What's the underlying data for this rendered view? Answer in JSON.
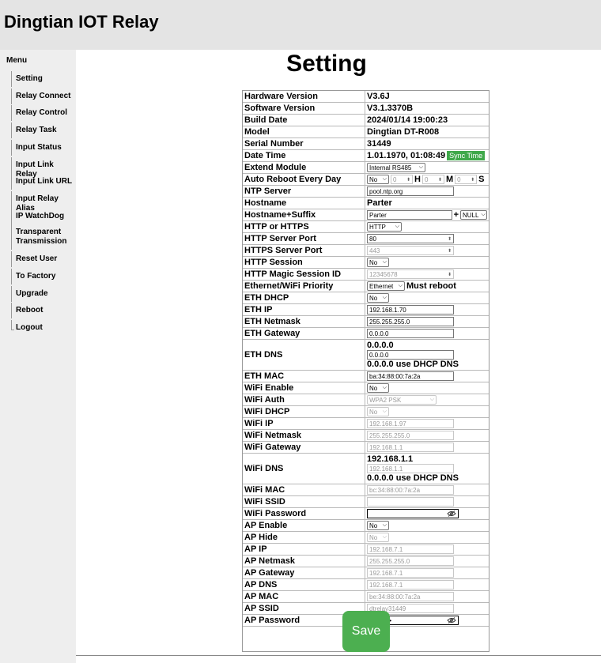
{
  "app_title": "Dingtian IOT Relay",
  "menu": {
    "title": "Menu",
    "items": [
      {
        "label": "Setting"
      },
      {
        "label": "Relay Connect"
      },
      {
        "label": "Relay Control"
      },
      {
        "label": "Relay Task"
      },
      {
        "label": "Input Status"
      },
      {
        "label": "Input Link Relay"
      },
      {
        "label": "Input Link URL"
      },
      {
        "label": "Input Relay Alias"
      },
      {
        "label": "IP WatchDog"
      },
      {
        "label": "Transparent Transmission"
      },
      {
        "label": "Reset User"
      },
      {
        "label": "To Factory"
      },
      {
        "label": "Upgrade"
      },
      {
        "label": "Reboot"
      },
      {
        "label": "Logout"
      }
    ]
  },
  "page_title": "Setting",
  "rows": {
    "hardware_version": {
      "label": "Hardware Version",
      "value": "V3.6J"
    },
    "software_version": {
      "label": "Software Version",
      "value": "V3.1.3370B"
    },
    "build_date": {
      "label": "Build Date",
      "value": "2024/01/14 19:00:23"
    },
    "model": {
      "label": "Model",
      "value": "Dingtian DT-R008"
    },
    "serial_number": {
      "label": "Serial Number",
      "value": "31449"
    },
    "date_time": {
      "label": "Date Time",
      "value": "1.01.1970, 01:08:49",
      "button": "Sync Time"
    },
    "extend_module": {
      "label": "Extend Module",
      "selected": "Internal RS485"
    },
    "auto_reboot": {
      "label": "Auto Reboot Every Day",
      "enable": "No",
      "hour": "0",
      "h_label": "H",
      "minute": "0",
      "m_label": "M",
      "second": "0",
      "s_label": "S"
    },
    "ntp_server": {
      "label": "NTP Server",
      "value": "pool.ntp.org"
    },
    "hostname": {
      "label": "Hostname",
      "value": "Parter"
    },
    "hostname_suffix": {
      "label": "Hostname+Suffix",
      "value": "Parter",
      "plus": "+",
      "suffix": "NULL"
    },
    "http_or_https": {
      "label": "HTTP or HTTPS",
      "selected": "HTTP"
    },
    "http_port": {
      "label": "HTTP Server Port",
      "value": "80"
    },
    "https_port": {
      "label": "HTTPS Server Port",
      "value": "443"
    },
    "http_session": {
      "label": "HTTP Session",
      "selected": "No"
    },
    "http_magic": {
      "label": "HTTP Magic Session ID",
      "value": "12345678"
    },
    "priority": {
      "label": "Ethernet/WiFi Priority",
      "selected": "Ethernet",
      "note": "Must reboot"
    },
    "eth_dhcp": {
      "label": "ETH DHCP",
      "selected": "No"
    },
    "eth_ip": {
      "label": "ETH IP",
      "value": "192.168.1.70"
    },
    "eth_netmask": {
      "label": "ETH Netmask",
      "value": "255.255.255.0"
    },
    "eth_gateway": {
      "label": "ETH Gateway",
      "value": "0.0.0.0"
    },
    "eth_dns": {
      "label": "ETH DNS",
      "top": "0.0.0.0",
      "value": "0.0.0.0",
      "note": "0.0.0.0 use DHCP DNS"
    },
    "eth_mac": {
      "label": "ETH MAC",
      "value": "ba:34:88:00:7a:2a"
    },
    "wifi_enable": {
      "label": "WiFi Enable",
      "selected": "No"
    },
    "wifi_auth": {
      "label": "WiFi Auth",
      "selected": "WPA2 PSK"
    },
    "wifi_dhcp": {
      "label": "WiFi DHCP",
      "selected": "No"
    },
    "wifi_ip": {
      "label": "WiFi IP",
      "value": "192.168.1.97"
    },
    "wifi_netmask": {
      "label": "WiFi Netmask",
      "value": "255.255.255.0"
    },
    "wifi_gateway": {
      "label": "WiFi Gateway",
      "value": "192.168.1.1"
    },
    "wifi_dns": {
      "label": "WiFi DNS",
      "top": "192.168.1.1",
      "value": "192.168.1.1",
      "note": "0.0.0.0 use DHCP DNS"
    },
    "wifi_mac": {
      "label": "WiFi MAC",
      "value": "bc:34:88:00:7a:2a"
    },
    "wifi_ssid": {
      "label": "WiFi SSID",
      "value": ""
    },
    "wifi_password": {
      "label": "WiFi Password",
      "value": ""
    },
    "ap_enable": {
      "label": "AP Enable",
      "selected": "No"
    },
    "ap_hide": {
      "label": "AP Hide",
      "selected": "No"
    },
    "ap_ip": {
      "label": "AP IP",
      "value": "192.168.7.1"
    },
    "ap_netmask": {
      "label": "AP Netmask",
      "value": "255.255.255.0"
    },
    "ap_gateway": {
      "label": "AP Gateway",
      "value": "192.168.7.1"
    },
    "ap_dns": {
      "label": "AP DNS",
      "value": "192.168.7.1"
    },
    "ap_mac": {
      "label": "AP MAC",
      "value": "be:34:88:00:7a:2a"
    },
    "ap_ssid": {
      "label": "AP SSID",
      "value": "dtrelay31449"
    },
    "ap_password": {
      "label": "AP Password",
      "value": "••••••••••"
    }
  },
  "save_label": "Save",
  "icons": {
    "eye_off": "eye-off-icon",
    "chevron": "chevron-down-icon",
    "spinner": "spinner-arrows-icon"
  },
  "colors": {
    "header_bg": "#e4e4e4",
    "sidebar_bg": "#eeeeee",
    "save_green": "#4caf50",
    "sync_green": "#3fa84a"
  }
}
